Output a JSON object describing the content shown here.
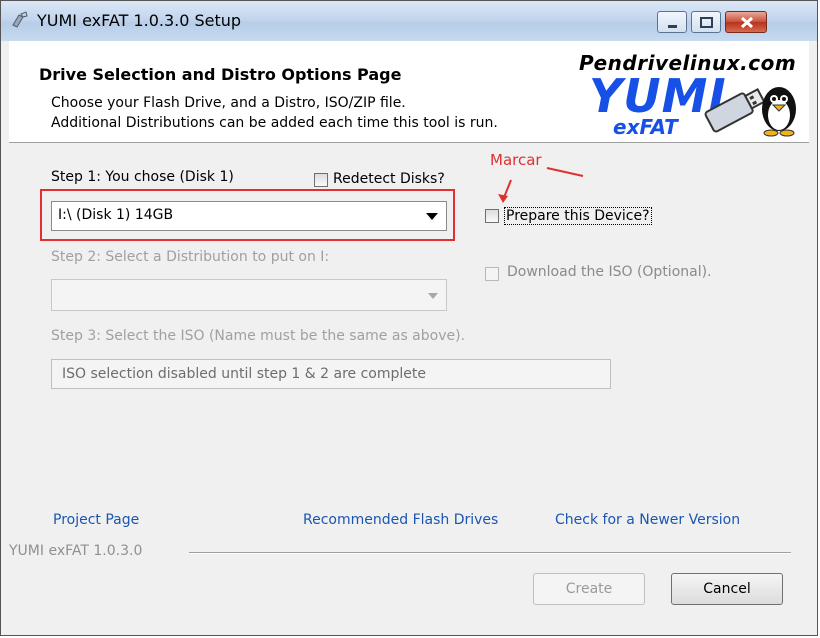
{
  "window": {
    "title": "YUMI exFAT 1.0.3.0 Setup"
  },
  "header": {
    "title": "Drive Selection and Distro Options Page",
    "line1": "Choose your Flash Drive, and a Distro, ISO/ZIP file.",
    "line2": "Additional Distributions can be added each time this tool is run.",
    "logo_site": "Pendrivelinux.com",
    "logo_name": "YUMI",
    "logo_sub": "exFAT"
  },
  "step1": {
    "label": "Step 1: You chose (Disk 1)",
    "drive_value": "I:\\ (Disk 1) 14GB",
    "redetect_label": "Redetect Disks?",
    "redetect_checked": false
  },
  "prepare": {
    "label": "Prepare this Device?",
    "checked": false
  },
  "annotation": {
    "text": "Marcar",
    "color": "#e03030"
  },
  "step2": {
    "label": "Step 2: Select a Distribution to put on I:",
    "value": ""
  },
  "download": {
    "label": "Download the ISO (Optional).",
    "checked": false
  },
  "step3": {
    "label": "Step 3: Select the ISO (Name must be the same as above).",
    "field_text": "ISO selection disabled until step 1 & 2 are complete"
  },
  "links": {
    "project": "Project Page",
    "recommended": "Recommended Flash Drives",
    "newer": "Check for a Newer Version"
  },
  "footer": {
    "version": "YUMI exFAT 1.0.3.0"
  },
  "buttons": {
    "create": "Create",
    "cancel": "Cancel"
  },
  "colors": {
    "link": "#1a56b0",
    "logo_blue": "#1650e6",
    "annotation_red": "#e03030"
  }
}
